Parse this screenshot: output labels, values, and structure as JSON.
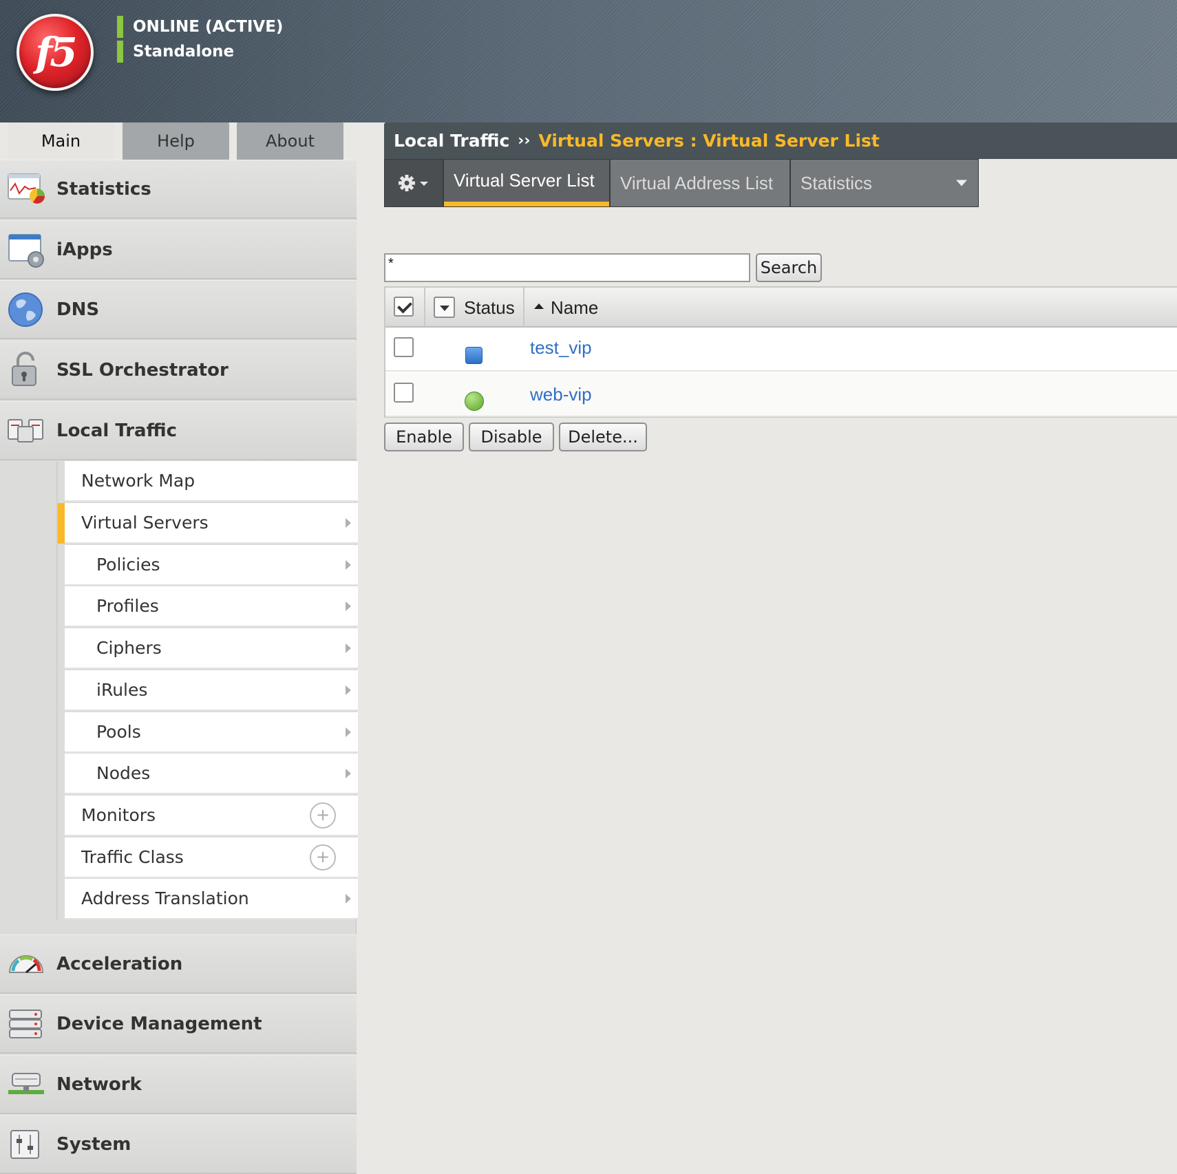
{
  "header": {
    "logo_text": "f5",
    "status": "ONLINE (ACTIVE)",
    "mode": "Standalone"
  },
  "top_tabs": [
    {
      "label": "Main",
      "active": true
    },
    {
      "label": "Help",
      "active": false
    },
    {
      "label": "About",
      "active": false
    }
  ],
  "sidebar": {
    "sections": [
      {
        "label": "Statistics",
        "icon": "statistics-icon"
      },
      {
        "label": "iApps",
        "icon": "iapps-icon"
      },
      {
        "label": "DNS",
        "icon": "globe-icon"
      },
      {
        "label": "SSL Orchestrator",
        "icon": "lock-icon"
      },
      {
        "label": "Local Traffic",
        "icon": "local-traffic-icon"
      },
      {
        "label": "Acceleration",
        "icon": "gauge-icon"
      },
      {
        "label": "Device Management",
        "icon": "server-stack-icon"
      },
      {
        "label": "Network",
        "icon": "network-icon"
      },
      {
        "label": "System",
        "icon": "system-icon"
      }
    ],
    "local_traffic_items": [
      {
        "label": "Network Map",
        "indent": 1,
        "control": "none"
      },
      {
        "label": "Virtual Servers",
        "indent": 1,
        "control": "arrow",
        "selected": true
      },
      {
        "label": "Policies",
        "indent": 2,
        "control": "arrow"
      },
      {
        "label": "Profiles",
        "indent": 2,
        "control": "arrow"
      },
      {
        "label": "Ciphers",
        "indent": 2,
        "control": "arrow"
      },
      {
        "label": "iRules",
        "indent": 2,
        "control": "arrow"
      },
      {
        "label": "Pools",
        "indent": 2,
        "control": "arrow"
      },
      {
        "label": "Nodes",
        "indent": 2,
        "control": "arrow"
      },
      {
        "label": "Monitors",
        "indent": 1,
        "control": "plus"
      },
      {
        "label": "Traffic Class",
        "indent": 1,
        "control": "plus"
      },
      {
        "label": "Address Translation",
        "indent": 1,
        "control": "arrow"
      }
    ]
  },
  "breadcrumb": {
    "root": "Local Traffic",
    "separator": "››",
    "current": "Virtual Servers : Virtual Server List"
  },
  "subtabs": [
    {
      "label": "Virtual Server List",
      "active": true
    },
    {
      "label": "Virtual Address List",
      "active": false
    },
    {
      "label": "Statistics",
      "active": false,
      "dropdown": true
    }
  ],
  "search": {
    "value": "*",
    "button": "Search"
  },
  "table": {
    "columns": {
      "status": "Status",
      "name": "Name"
    },
    "rows": [
      {
        "name": "test_vip",
        "status": "unknown",
        "status_color": "#3a86d6"
      },
      {
        "name": "web-vip",
        "status": "available",
        "status_color": "#6dbb34"
      }
    ]
  },
  "actions": {
    "enable": "Enable",
    "disable": "Disable",
    "delete": "Delete..."
  },
  "colors": {
    "accent": "#f9b928",
    "link": "#2f6fc6",
    "status_ok": "#8dc63f"
  }
}
